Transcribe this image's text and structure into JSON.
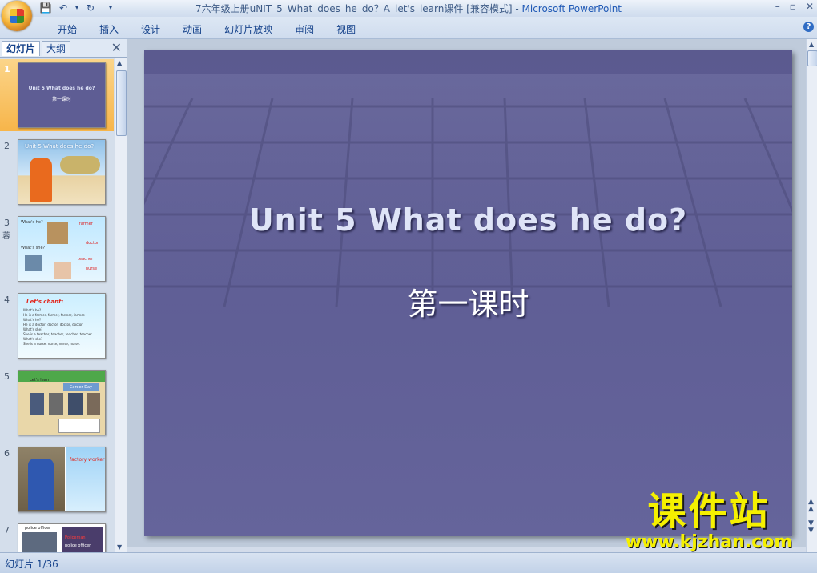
{
  "window": {
    "title_prefix": "7六年级上册uNIT_5_What_does_he_do？A_let's_learn课件 [兼容模式] - ",
    "title_app": "Microsoft PowerPoint",
    "controls": [
      "–",
      "▫",
      "✕"
    ]
  },
  "qat": {
    "save_icon": "💾",
    "undo_icon": "↶",
    "dropdown": "▾",
    "redo_icon": "↻",
    "more": "▾"
  },
  "ribbon": {
    "tabs": [
      "开始",
      "插入",
      "设计",
      "动画",
      "幻灯片放映",
      "审阅",
      "视图"
    ],
    "help": "?"
  },
  "left_pane": {
    "tab_slides": "幻灯片",
    "tab_outline": "大纲",
    "close": "✕",
    "thumbs": [
      {
        "num": "1",
        "selected": true,
        "anim": "",
        "title": "Unit  5  What does he do?",
        "sub": "第一课时"
      },
      {
        "num": "2",
        "selected": false,
        "anim": "",
        "title": "Unit 5 What does he do?"
      },
      {
        "num": "3",
        "selected": false,
        "anim": "蓉",
        "lines": [
          "What's he?",
          "farmer",
          "doctor",
          "What's she?",
          "teacher",
          "nurse"
        ]
      },
      {
        "num": "4",
        "selected": false,
        "anim": "",
        "heading": "Let's chant:",
        "lines": [
          "What's he?",
          "He is a farmer, farmer, farmer, farmer.",
          "What's he?",
          "He is a doctor, doctor, doctor, doctor.",
          "What's she?",
          "She is a teacher, teacher, teacher, teacher.",
          "What's she?",
          "She is a nurse, nurse, nurse, nurse."
        ]
      },
      {
        "num": "5",
        "selected": false,
        "anim": "",
        "heading": "Let's learn",
        "banner": "Career Day"
      },
      {
        "num": "6",
        "selected": false,
        "anim": "",
        "label": "factory worker"
      },
      {
        "num": "7",
        "selected": false,
        "anim": "",
        "label": "police officer",
        "label2": "Policeman",
        "label3": "police officer"
      }
    ]
  },
  "slide": {
    "title": "Unit  5  What does he do?",
    "subtitle": "第一课时"
  },
  "watermark": {
    "big": "课件站",
    "url": "www.kjzhan.com"
  },
  "status": {
    "text": "幻灯片 1/36"
  },
  "colors": {
    "slide_bg": "#5e5d94",
    "selected_thumb": "#f7b54a",
    "watermark": "#f5f000"
  }
}
